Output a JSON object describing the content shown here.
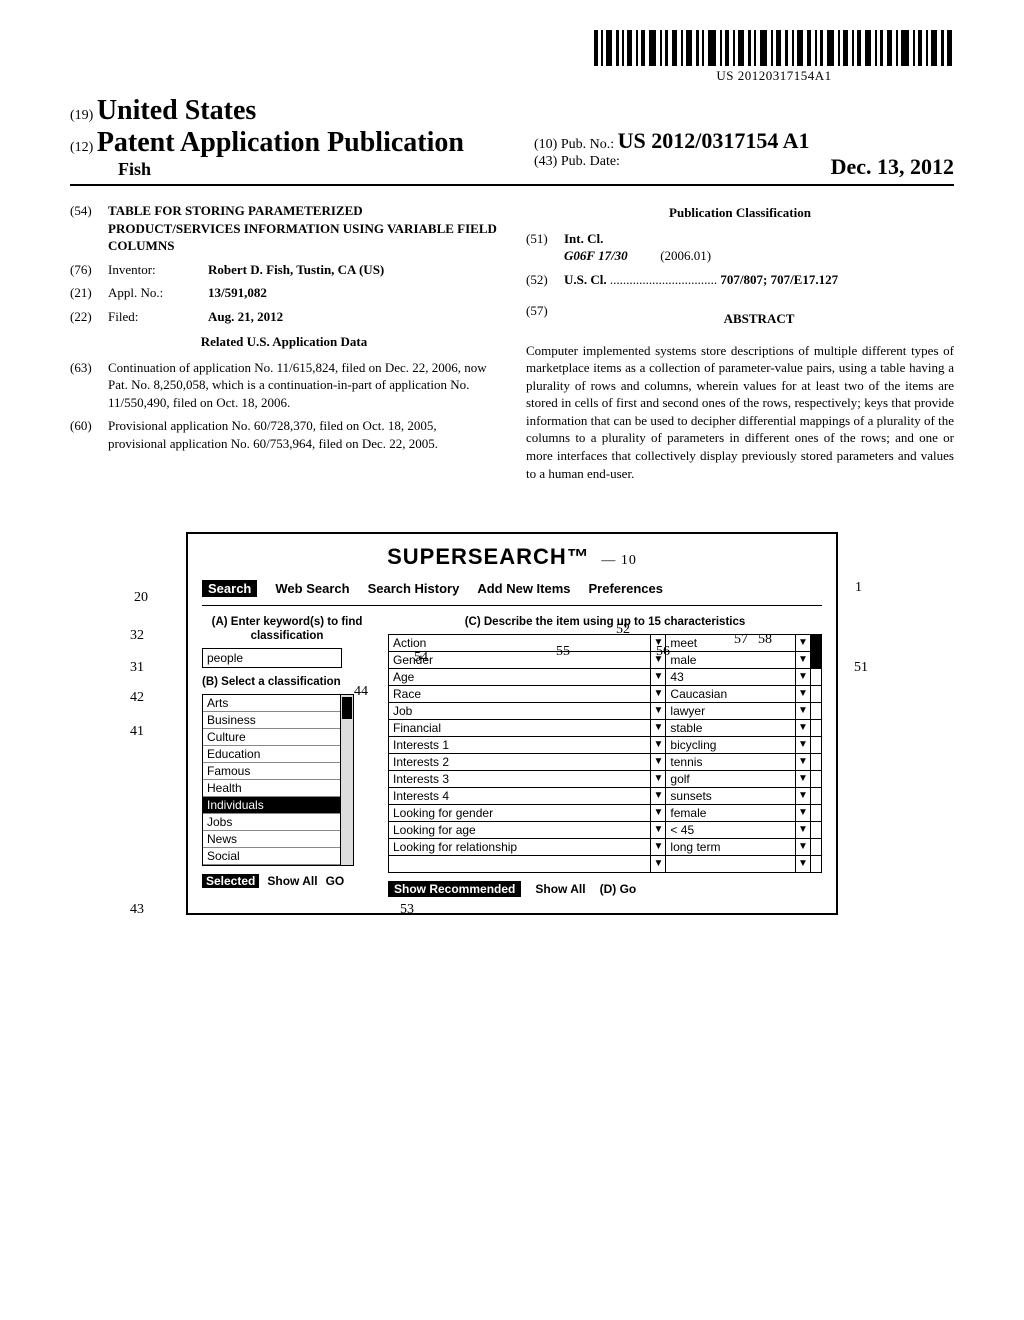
{
  "barcode_text": "US 20120317154A1",
  "header": {
    "num19": "(19)",
    "country": "United States",
    "num12": "(12)",
    "pub_type": "Patent Application Publication",
    "inventor_short": "Fish",
    "num10": "(10)",
    "pubno_label": "Pub. No.:",
    "pubno": "US 2012/0317154 A1",
    "num43": "(43)",
    "pubdate_label": "Pub. Date:",
    "pubdate": "Dec. 13, 2012"
  },
  "left": {
    "f54_num": "(54)",
    "f54_title": "TABLE FOR STORING PARAMETERIZED PRODUCT/SERVICES INFORMATION USING VARIABLE FIELD COLUMNS",
    "f76_num": "(76)",
    "f76_label": "Inventor:",
    "f76_val": "Robert D. Fish, Tustin, CA (US)",
    "f21_num": "(21)",
    "f21_label": "Appl. No.:",
    "f21_val": "13/591,082",
    "f22_num": "(22)",
    "f22_label": "Filed:",
    "f22_val": "Aug. 21, 2012",
    "related_head": "Related U.S. Application Data",
    "f63_num": "(63)",
    "f63_text": "Continuation of application No. 11/615,824, filed on Dec. 22, 2006, now Pat. No. 8,250,058, which is a continuation-in-part of application No. 11/550,490, filed on Oct. 18, 2006.",
    "f60_num": "(60)",
    "f60_text": "Provisional application No. 60/728,370, filed on Oct. 18, 2005, provisional application No. 60/753,964, filed on Dec. 22, 2005."
  },
  "right": {
    "pubclass_head": "Publication Classification",
    "f51_num": "(51)",
    "f51_label": "Int. Cl.",
    "f51_code": "G06F 17/30",
    "f51_date": "(2006.01)",
    "f52_num": "(52)",
    "f52_label": "U.S. Cl.",
    "f52_dots": " ................................. ",
    "f52_val": "707/807; 707/E17.127",
    "f57_num": "(57)",
    "abstract_head": "ABSTRACT",
    "abstract_text": "Computer implemented systems store descriptions of multiple different types of marketplace items as a collection of parameter-value pairs, using a table having a plurality of rows and columns, wherein values for at least two of the items are stored in cells of first and second ones of the rows, respectively; keys that provide information that can be used to decipher differential mappings of a plurality of the columns to a plurality of parameters in different ones of the rows; and one or more interfaces that collectively display previously stored parameters and values to a human end-user."
  },
  "figure": {
    "title": "SUPERSEARCH™",
    "ref10": "10",
    "tabs": {
      "search": "Search",
      "web": "Web Search",
      "history": "Search History",
      "addnew": "Add New Items",
      "prefs": "Preferences"
    },
    "ref20": "20",
    "ref1": "1",
    "panelA": {
      "head": "(A)  Enter keyword(s) to find classification",
      "keyword": "people",
      "ref32": "32",
      "ref31": "31",
      "ref42": "42",
      "ref44": "44",
      "subhead": "(B)  Select a classification",
      "items": [
        "Arts",
        "Business",
        "Culture",
        "Education",
        "Famous",
        "Health",
        "Individuals",
        "Jobs",
        "News",
        "Social",
        ""
      ],
      "selected_index": 6,
      "ref41": "41",
      "foot_selected": "Selected",
      "foot_showall": "Show All",
      "foot_go": "GO",
      "ref43": "43"
    },
    "panelC": {
      "head": "(C)  Describe the item using up to 15 characteristics",
      "ref52": "52",
      "ref54": "54",
      "ref55": "55",
      "ref56": "56",
      "ref57": "57",
      "ref58": "58",
      "ref51": "51",
      "rows": [
        {
          "k": "Action",
          "v": "meet",
          "s": true
        },
        {
          "k": "Gender",
          "v": "male",
          "s": true
        },
        {
          "k": "Age",
          "v": "43",
          "s": false
        },
        {
          "k": "Race",
          "v": "Caucasian",
          "s": false
        },
        {
          "k": "Job",
          "v": "lawyer",
          "s": false
        },
        {
          "k": "Financial",
          "v": "stable",
          "s": false
        },
        {
          "k": "Interests 1",
          "v": "bicycling",
          "s": false
        },
        {
          "k": "Interests 2",
          "v": "tennis",
          "s": false
        },
        {
          "k": "Interests 3",
          "v": "golf",
          "s": false
        },
        {
          "k": "Interests 4",
          "v": "sunsets",
          "s": false
        },
        {
          "k": "Looking for gender",
          "v": "female",
          "s": false
        },
        {
          "k": "Looking for age",
          "v": "< 45",
          "s": false
        },
        {
          "k": "Looking for relationship",
          "v": "long term",
          "s": false
        },
        {
          "k": "",
          "v": "",
          "s": false
        }
      ],
      "foot_rec": "Show Recommended",
      "foot_showall": "Show All",
      "foot_go": "(D) Go",
      "ref53": "53"
    }
  }
}
